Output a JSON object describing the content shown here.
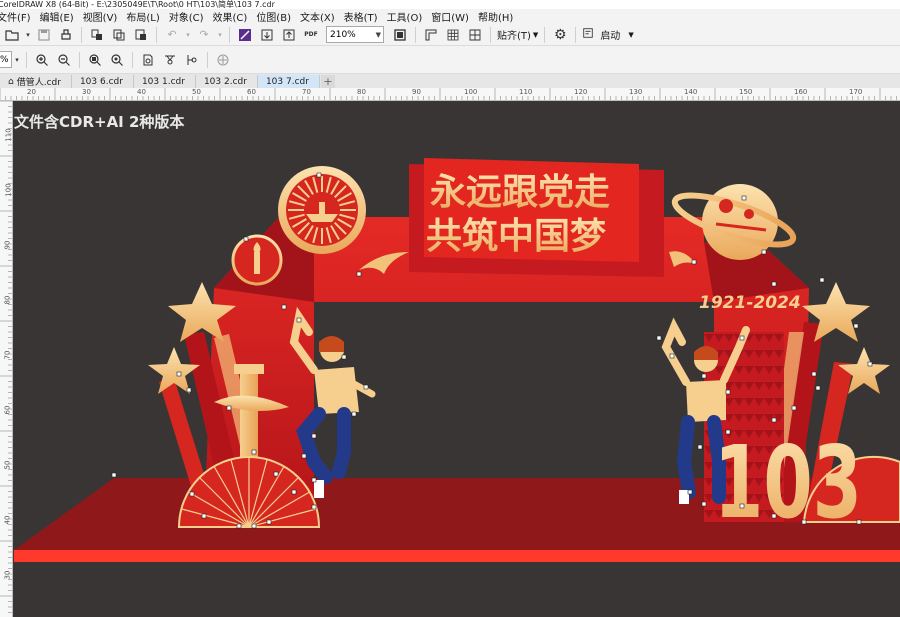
{
  "window": {
    "title": "CorelDRAW X8 (64-Bit) - E:\\2305049E\\T\\Root\\0 HT\\103\\简单\\103 7.cdr"
  },
  "menu": [
    {
      "label": "文件(F)"
    },
    {
      "label": "编辑(E)"
    },
    {
      "label": "视图(V)"
    },
    {
      "label": "布局(L)"
    },
    {
      "label": "对象(C)"
    },
    {
      "label": "效果(C)"
    },
    {
      "label": "位图(B)"
    },
    {
      "label": "文本(X)"
    },
    {
      "label": "表格(T)"
    },
    {
      "label": "工具(O)"
    },
    {
      "label": "窗口(W)"
    },
    {
      "label": "帮助(H)"
    }
  ],
  "toolbar": {
    "zoom_value": "210%",
    "snap_label": "贴齐(T)",
    "launch_label": "启动",
    "small_zoom_value": "%"
  },
  "tabs": [
    {
      "label": "借管人.cdr"
    },
    {
      "label": "103 6.cdr"
    },
    {
      "label": "103 1.cdr"
    },
    {
      "label": "103 2.cdr"
    },
    {
      "label": "103 7.cdr"
    }
  ],
  "ruler_h_labels": [
    "20",
    "30",
    "40",
    "50",
    "60",
    "70",
    "80",
    "90",
    "100",
    "110",
    "120",
    "130",
    "140",
    "150",
    "160",
    "170"
  ],
  "ruler_v_labels": [
    "110",
    "100",
    "90",
    "80",
    "70",
    "60",
    "50",
    "40",
    "30"
  ],
  "canvas": {
    "note": "文件含CDR+AI 2种版本",
    "headline_1": "永远跟党走",
    "headline_2": "共筑中国梦",
    "years": "1921-2024",
    "big_number": "103"
  },
  "colors": {
    "canvas_bg": "#3a3535",
    "arch_red": "#d21e24",
    "dark_red": "#9a1518",
    "gold": "#f4c57a",
    "floor_red": "#8f181b",
    "floor_stripe": "#ff3a2c"
  }
}
